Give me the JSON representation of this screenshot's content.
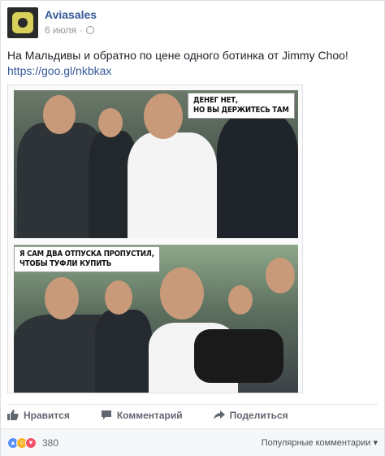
{
  "post": {
    "page_name": "Aviasales",
    "date": "6 июля",
    "text": "На Мальдивы и обратно по цене одного ботинка от Jimmy Choo!",
    "link": "https://goo.gl/nkbkax"
  },
  "meme": {
    "caption_top_1": "ДЕНЕГ НЕТ,",
    "caption_top_2": "НО ВЫ ДЕРЖИТЕСЬ ТАМ",
    "caption_bottom_1": "Я САМ ДВА ОТПУСКА ПРОПУСТИЛ,",
    "caption_bottom_2": "ЧТОБЫ ТУФЛИ КУПИТЬ"
  },
  "actions": {
    "like": "Нравится",
    "comment": "Комментарий",
    "share": "Поделиться"
  },
  "footer": {
    "reaction_count": "380",
    "sort_label": "Популярные комментарии ▾"
  },
  "colors": {
    "link": "#365899",
    "like_blue": "#5890ff",
    "haha_yellow": "#f7b125",
    "love_red": "#f25268"
  }
}
